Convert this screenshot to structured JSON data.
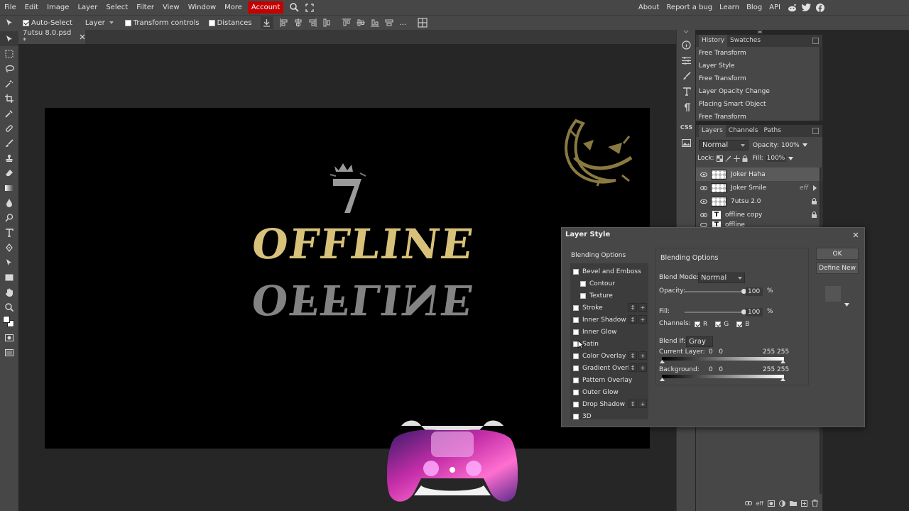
{
  "menubar": {
    "items": [
      "File",
      "Edit",
      "Image",
      "Layer",
      "Select",
      "Filter",
      "View",
      "Window",
      "More",
      "Account"
    ],
    "right": [
      "About",
      "Report a bug",
      "Learn",
      "Blog",
      "API"
    ]
  },
  "optbar": {
    "auto_select": "Auto-Select",
    "target": "Layer",
    "transform_controls": "Transform controls",
    "distances": "Distances",
    "more": "..."
  },
  "document": {
    "tab_title": "7utsu 8.0.psd *"
  },
  "history": {
    "tabs": [
      "History",
      "Swatches"
    ],
    "items": [
      "Free Transform",
      "Layer Style",
      "Free Transform",
      "Layer Opacity Change",
      "Placing Smart Object",
      "Free Transform"
    ]
  },
  "layers": {
    "tabs": [
      "Layers",
      "Channels",
      "Paths"
    ],
    "blend_mode": "Normal",
    "opacity_label": "Opacity:",
    "opacity": "100%",
    "lock_label": "Lock:",
    "fill_label": "Fill:",
    "fill": "100%",
    "items": [
      {
        "name": "Joker Haha"
      },
      {
        "name": "Joker Smile",
        "badge": "eff"
      },
      {
        "name": "7utsu 2.0"
      },
      {
        "name": "offline copy"
      },
      {
        "name": "offline"
      }
    ]
  },
  "dialog": {
    "title": "Layer Style",
    "list_header": "Blending Options",
    "styles": [
      {
        "label": "Bevel and Emboss",
        "indent": false,
        "buttons": false
      },
      {
        "label": "Contour",
        "indent": true,
        "buttons": false
      },
      {
        "label": "Texture",
        "indent": true,
        "buttons": false
      },
      {
        "label": "Stroke",
        "indent": false,
        "buttons": true
      },
      {
        "label": "Inner Shadow",
        "indent": false,
        "buttons": true
      },
      {
        "label": "Inner Glow",
        "indent": false,
        "buttons": false
      },
      {
        "label": "Satin",
        "indent": false,
        "buttons": false
      },
      {
        "label": "Color Overlay",
        "indent": false,
        "buttons": true
      },
      {
        "label": "Gradient Overlay",
        "indent": false,
        "buttons": true
      },
      {
        "label": "Pattern Overlay",
        "indent": false,
        "buttons": false
      },
      {
        "label": "Outer Glow",
        "indent": false,
        "buttons": false
      },
      {
        "label": "Drop Shadow",
        "indent": false,
        "buttons": true
      },
      {
        "label": "3D",
        "indent": false,
        "buttons": false
      }
    ],
    "section_title": "Blending Options",
    "blend_mode_label": "Blend Mode:",
    "blend_mode": "Normal",
    "opacity_label": "Opacity:",
    "opacity": "100",
    "fill_label": "Fill:",
    "fill": "100",
    "percent": "%",
    "channels_label": "Channels:",
    "channels": [
      "R",
      "G",
      "B"
    ],
    "blend_if_label": "Blend If:",
    "blend_if": "Gray",
    "current_layer_label": "Current Layer:",
    "current_layer_values": "0   0",
    "current_layer_values_hi": "255 255",
    "background_label": "Background:",
    "background_values": "0   0",
    "background_values_hi": "255 255",
    "ok": "OK",
    "define_new": "Define New"
  },
  "canvas": {
    "artwork_text": "OFFLINE",
    "artwork_colors": {
      "gold": "#d8c27a",
      "gray": "#9a9a9a",
      "olive": "#8a7a40"
    }
  }
}
